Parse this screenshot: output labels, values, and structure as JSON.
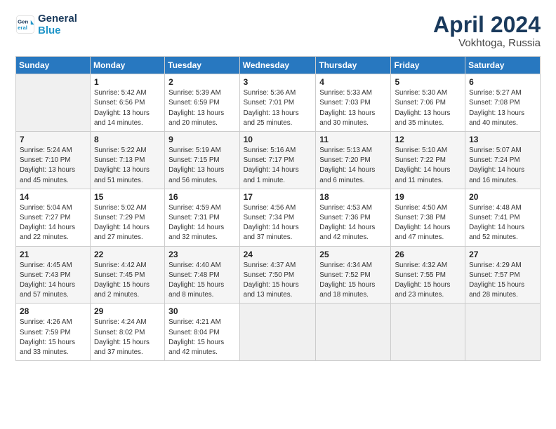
{
  "header": {
    "title": "April 2024",
    "location": "Vokhtoga, Russia",
    "logo_line1": "General",
    "logo_line2": "Blue"
  },
  "weekdays": [
    "Sunday",
    "Monday",
    "Tuesday",
    "Wednesday",
    "Thursday",
    "Friday",
    "Saturday"
  ],
  "weeks": [
    [
      {
        "day": "",
        "sunrise": "",
        "sunset": "",
        "daylight": ""
      },
      {
        "day": "1",
        "sunrise": "Sunrise: 5:42 AM",
        "sunset": "Sunset: 6:56 PM",
        "daylight": "Daylight: 13 hours and 14 minutes."
      },
      {
        "day": "2",
        "sunrise": "Sunrise: 5:39 AM",
        "sunset": "Sunset: 6:59 PM",
        "daylight": "Daylight: 13 hours and 20 minutes."
      },
      {
        "day": "3",
        "sunrise": "Sunrise: 5:36 AM",
        "sunset": "Sunset: 7:01 PM",
        "daylight": "Daylight: 13 hours and 25 minutes."
      },
      {
        "day": "4",
        "sunrise": "Sunrise: 5:33 AM",
        "sunset": "Sunset: 7:03 PM",
        "daylight": "Daylight: 13 hours and 30 minutes."
      },
      {
        "day": "5",
        "sunrise": "Sunrise: 5:30 AM",
        "sunset": "Sunset: 7:06 PM",
        "daylight": "Daylight: 13 hours and 35 minutes."
      },
      {
        "day": "6",
        "sunrise": "Sunrise: 5:27 AM",
        "sunset": "Sunset: 7:08 PM",
        "daylight": "Daylight: 13 hours and 40 minutes."
      }
    ],
    [
      {
        "day": "7",
        "sunrise": "Sunrise: 5:24 AM",
        "sunset": "Sunset: 7:10 PM",
        "daylight": "Daylight: 13 hours and 45 minutes."
      },
      {
        "day": "8",
        "sunrise": "Sunrise: 5:22 AM",
        "sunset": "Sunset: 7:13 PM",
        "daylight": "Daylight: 13 hours and 51 minutes."
      },
      {
        "day": "9",
        "sunrise": "Sunrise: 5:19 AM",
        "sunset": "Sunset: 7:15 PM",
        "daylight": "Daylight: 13 hours and 56 minutes."
      },
      {
        "day": "10",
        "sunrise": "Sunrise: 5:16 AM",
        "sunset": "Sunset: 7:17 PM",
        "daylight": "Daylight: 14 hours and 1 minute."
      },
      {
        "day": "11",
        "sunrise": "Sunrise: 5:13 AM",
        "sunset": "Sunset: 7:20 PM",
        "daylight": "Daylight: 14 hours and 6 minutes."
      },
      {
        "day": "12",
        "sunrise": "Sunrise: 5:10 AM",
        "sunset": "Sunset: 7:22 PM",
        "daylight": "Daylight: 14 hours and 11 minutes."
      },
      {
        "day": "13",
        "sunrise": "Sunrise: 5:07 AM",
        "sunset": "Sunset: 7:24 PM",
        "daylight": "Daylight: 14 hours and 16 minutes."
      }
    ],
    [
      {
        "day": "14",
        "sunrise": "Sunrise: 5:04 AM",
        "sunset": "Sunset: 7:27 PM",
        "daylight": "Daylight: 14 hours and 22 minutes."
      },
      {
        "day": "15",
        "sunrise": "Sunrise: 5:02 AM",
        "sunset": "Sunset: 7:29 PM",
        "daylight": "Daylight: 14 hours and 27 minutes."
      },
      {
        "day": "16",
        "sunrise": "Sunrise: 4:59 AM",
        "sunset": "Sunset: 7:31 PM",
        "daylight": "Daylight: 14 hours and 32 minutes."
      },
      {
        "day": "17",
        "sunrise": "Sunrise: 4:56 AM",
        "sunset": "Sunset: 7:34 PM",
        "daylight": "Daylight: 14 hours and 37 minutes."
      },
      {
        "day": "18",
        "sunrise": "Sunrise: 4:53 AM",
        "sunset": "Sunset: 7:36 PM",
        "daylight": "Daylight: 14 hours and 42 minutes."
      },
      {
        "day": "19",
        "sunrise": "Sunrise: 4:50 AM",
        "sunset": "Sunset: 7:38 PM",
        "daylight": "Daylight: 14 hours and 47 minutes."
      },
      {
        "day": "20",
        "sunrise": "Sunrise: 4:48 AM",
        "sunset": "Sunset: 7:41 PM",
        "daylight": "Daylight: 14 hours and 52 minutes."
      }
    ],
    [
      {
        "day": "21",
        "sunrise": "Sunrise: 4:45 AM",
        "sunset": "Sunset: 7:43 PM",
        "daylight": "Daylight: 14 hours and 57 minutes."
      },
      {
        "day": "22",
        "sunrise": "Sunrise: 4:42 AM",
        "sunset": "Sunset: 7:45 PM",
        "daylight": "Daylight: 15 hours and 2 minutes."
      },
      {
        "day": "23",
        "sunrise": "Sunrise: 4:40 AM",
        "sunset": "Sunset: 7:48 PM",
        "daylight": "Daylight: 15 hours and 8 minutes."
      },
      {
        "day": "24",
        "sunrise": "Sunrise: 4:37 AM",
        "sunset": "Sunset: 7:50 PM",
        "daylight": "Daylight: 15 hours and 13 minutes."
      },
      {
        "day": "25",
        "sunrise": "Sunrise: 4:34 AM",
        "sunset": "Sunset: 7:52 PM",
        "daylight": "Daylight: 15 hours and 18 minutes."
      },
      {
        "day": "26",
        "sunrise": "Sunrise: 4:32 AM",
        "sunset": "Sunset: 7:55 PM",
        "daylight": "Daylight: 15 hours and 23 minutes."
      },
      {
        "day": "27",
        "sunrise": "Sunrise: 4:29 AM",
        "sunset": "Sunset: 7:57 PM",
        "daylight": "Daylight: 15 hours and 28 minutes."
      }
    ],
    [
      {
        "day": "28",
        "sunrise": "Sunrise: 4:26 AM",
        "sunset": "Sunset: 7:59 PM",
        "daylight": "Daylight: 15 hours and 33 minutes."
      },
      {
        "day": "29",
        "sunrise": "Sunrise: 4:24 AM",
        "sunset": "Sunset: 8:02 PM",
        "daylight": "Daylight: 15 hours and 37 minutes."
      },
      {
        "day": "30",
        "sunrise": "Sunrise: 4:21 AM",
        "sunset": "Sunset: 8:04 PM",
        "daylight": "Daylight: 15 hours and 42 minutes."
      },
      {
        "day": "",
        "sunrise": "",
        "sunset": "",
        "daylight": ""
      },
      {
        "day": "",
        "sunrise": "",
        "sunset": "",
        "daylight": ""
      },
      {
        "day": "",
        "sunrise": "",
        "sunset": "",
        "daylight": ""
      },
      {
        "day": "",
        "sunrise": "",
        "sunset": "",
        "daylight": ""
      }
    ]
  ]
}
